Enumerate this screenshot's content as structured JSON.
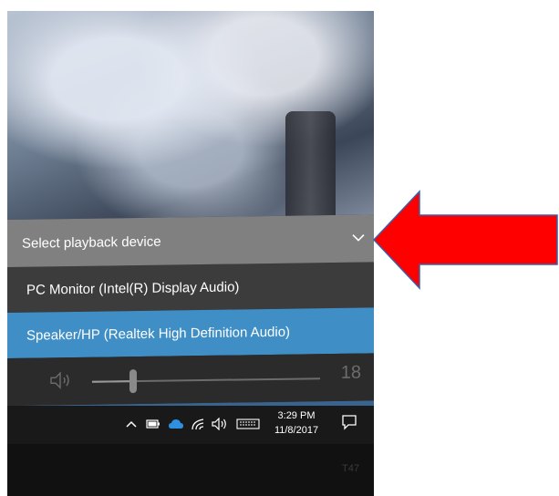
{
  "flyout": {
    "title": "Select playback device",
    "devices": [
      {
        "label": "PC Monitor (Intel(R) Display Audio)",
        "selected": false
      },
      {
        "label": "Speaker/HP (Realtek High Definition Audio)",
        "selected": true
      }
    ],
    "volume": {
      "value": "18",
      "level_percent": 18
    }
  },
  "taskbar": {
    "time": "3:29 PM",
    "date": "11/8/2017"
  },
  "bezel": {
    "label": "T47"
  },
  "colors": {
    "header_bg": "#808080",
    "selected_bg": "#3f8fc6",
    "panel_bg": "#2b2b2b",
    "taskbar_bg": "#191919",
    "annotation_red": "#ff0000",
    "annotation_border": "#3a5fa8"
  },
  "icons": {
    "chevron": "chevron-down-icon",
    "speaker": "speaker-icon",
    "tray_up": "chevron-up-icon",
    "battery": "battery-icon",
    "cloud": "onedrive-cloud-icon",
    "wifi": "wifi-icon",
    "volume": "volume-icon",
    "keyboard": "keyboard-icon",
    "notifications": "action-center-icon"
  }
}
